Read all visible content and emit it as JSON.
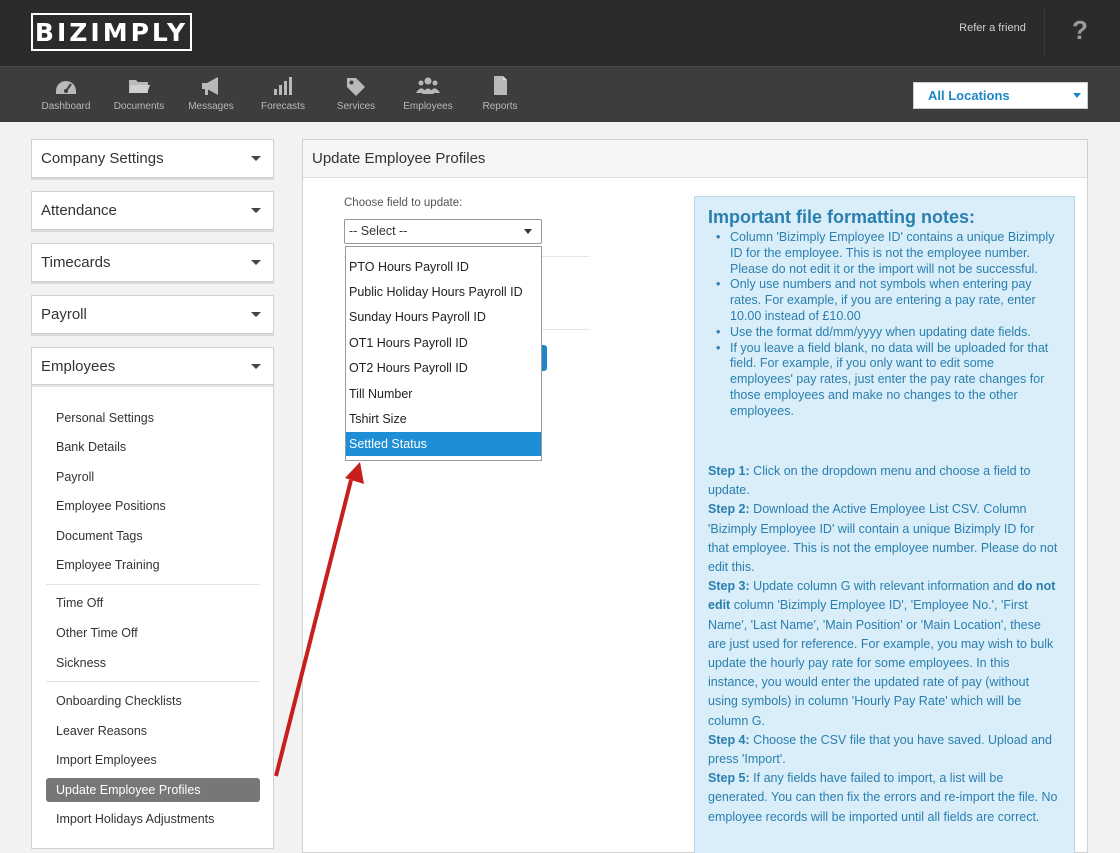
{
  "header": {
    "logo": "BIZIMPLY",
    "refer_label": "Refer a friend",
    "help_label": "?"
  },
  "nav": {
    "items": [
      {
        "label": "Dashboard",
        "icon": "dashboard-icon"
      },
      {
        "label": "Documents",
        "icon": "folder-icon"
      },
      {
        "label": "Messages",
        "icon": "megaphone-icon"
      },
      {
        "label": "Forecasts",
        "icon": "bar-chart-icon"
      },
      {
        "label": "Services",
        "icon": "tag-icon"
      },
      {
        "label": "Employees",
        "icon": "people-icon"
      },
      {
        "label": "Reports",
        "icon": "document-icon"
      }
    ],
    "location_select": "All Locations"
  },
  "sidebar": {
    "sections": [
      "Company Settings",
      "Attendance",
      "Timecards",
      "Payroll"
    ],
    "employees_title": "Employees",
    "links": [
      "Personal Settings",
      "Bank Details",
      "Payroll",
      "Employee Positions",
      "Document Tags",
      "Employee Training",
      "Time Off",
      "Other Time Off",
      "Sickness",
      "Onboarding Checklists",
      "Leaver Reasons",
      "Import Employees",
      "Update Employee Profiles",
      "Import Holidays Adjustments"
    ],
    "active": "Update Employee Profiles"
  },
  "main": {
    "title": "Update Employee Profiles",
    "choose_label": "Choose field to update:",
    "select_value": "-- Select --",
    "dropdown_options": [
      "PTO Hours Payroll ID",
      "Public Holiday Hours Payroll ID",
      "Sunday Hours Payroll ID",
      "OT1 Hours Payroll ID",
      "OT2 Hours Payroll ID",
      "Till Number",
      "Tshirt Size",
      "Settled Status"
    ],
    "dropdown_selected": "Settled Status"
  },
  "notes": {
    "title": "Important file formatting notes:",
    "bullets": [
      "Column 'Bizimply Employee ID' contains a unique Bizimply ID for the employee. This is not the employee number. Please do not edit it or the import will not be successful.",
      "Only use numbers and not symbols when entering pay rates. For example, if you are entering a pay rate, enter 10.00 instead of £10.00",
      "Use the format dd/mm/yyyy when updating date fields.",
      "If you leave a field blank, no data will be uploaded for that field. For example, if you only want to edit some employees' pay rates, just enter the pay rate changes for those employees and make no changes to the other employees."
    ],
    "step1_label": "Step 1:",
    "step1_text": " Click on the dropdown menu and choose a field to update.",
    "step2_label": "Step 2:",
    "step2_text": " Download the Active Employee List CSV. Column 'Bizimply Employee ID' will contain a unique Bizimply ID for that employee. This is not the employee number. Please do not edit this.",
    "step3_label": "Step 3:",
    "step3_text_a": " Update column G with relevant information and ",
    "step3_bold": "do not edit",
    "step3_text_b": " column 'Bizimply Employee ID', 'Employee No.', 'First Name', 'Last Name', 'Main Position' or 'Main Location', these are just used for reference. For example, you may wish to bulk update the hourly pay rate for some employees. In this instance, you would enter the updated rate of pay (without using symbols) in column 'Hourly Pay Rate' which will be column G.",
    "step4_label": "Step 4:",
    "step4_text": " Choose the CSV file that you have saved. Upload and press 'Import'.",
    "step5_label": "Step 5:",
    "step5_text": " If any fields have failed to import, a list will be generated. You can then fix the errors and re-import the file. No employee records will be imported until all fields are correct."
  },
  "colors": {
    "accent": "#1d86c8",
    "selected": "#1e8fd6",
    "annotation_arrow": "#c81e1e"
  }
}
